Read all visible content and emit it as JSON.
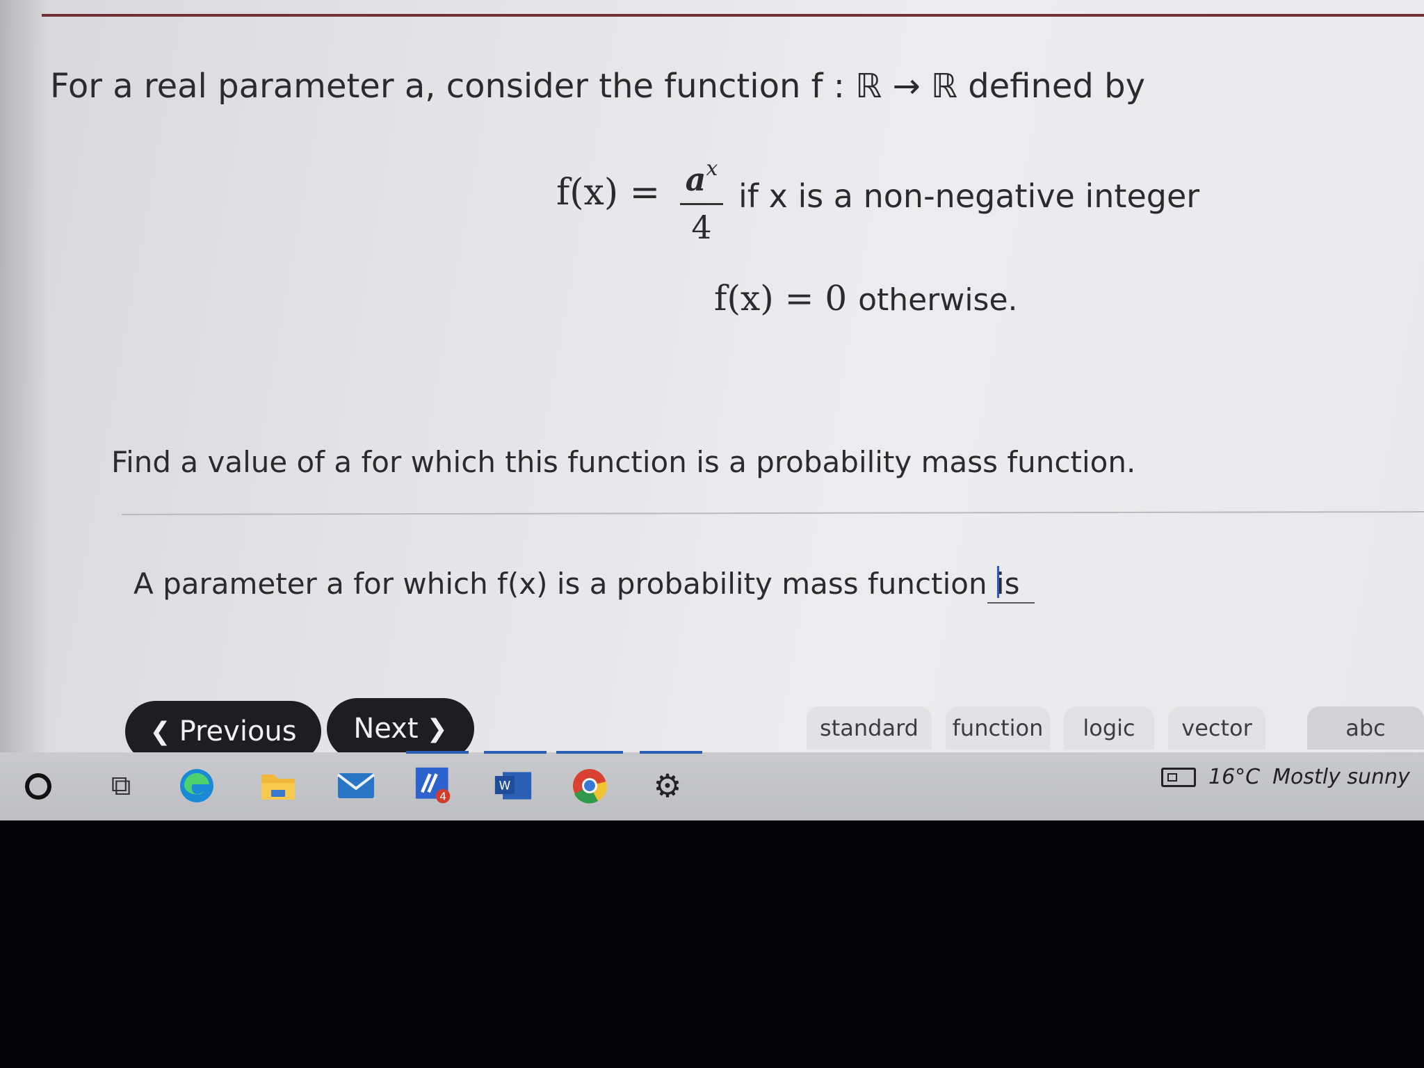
{
  "question": {
    "intro": "For a real parameter a, consider the function f : ℝ → ℝ defined by",
    "case1_lhs": "f(x) =",
    "case1_numerator_base": "a",
    "case1_numerator_exp": "x",
    "case1_denominator": "4",
    "case1_condition": "if x is a non-negative integer",
    "case2_expr": "f(x) = 0",
    "case2_condition": "otherwise.",
    "prompt": "Find a value of a for which this function is a probability mass function.",
    "answer_label": "A parameter a for which f(x) is a probability mass function is",
    "answer_value": ""
  },
  "nav": {
    "previous_label": "Previous",
    "next_label": "Next"
  },
  "keyboard_tabs": [
    "standard",
    "function",
    "logic",
    "vector",
    "abc"
  ],
  "taskbar": {
    "app_badge": "4",
    "word_letter": "W",
    "weather_temp": "16°C",
    "weather_desc": "Mostly sunny"
  },
  "colors": {
    "accent_rule": "#6f3037",
    "nav_button_bg": "#1d1d22",
    "caret": "#2f57c4"
  }
}
